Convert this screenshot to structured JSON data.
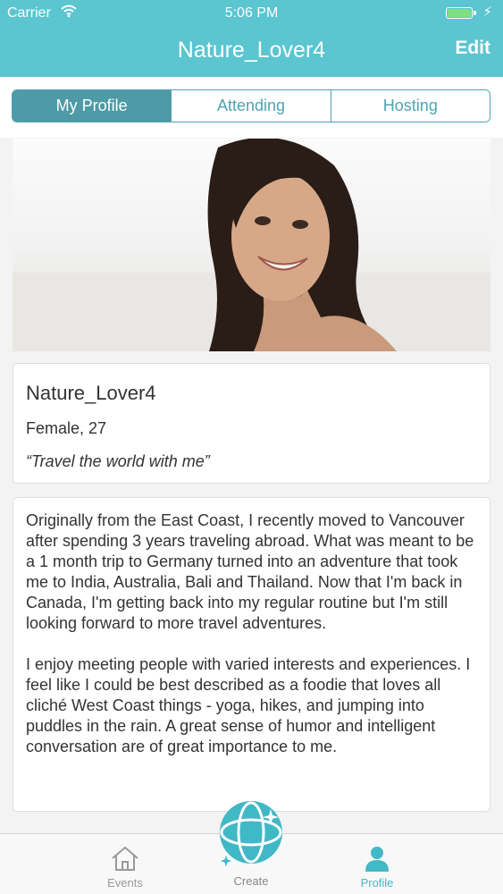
{
  "status_bar": {
    "carrier": "Carrier",
    "time": "5:06 PM",
    "battery_level": 1.0
  },
  "nav": {
    "title": "Nature_Lover4",
    "edit_label": "Edit"
  },
  "tabs": [
    {
      "label": "My Profile",
      "active": true
    },
    {
      "label": "Attending",
      "active": false
    },
    {
      "label": "Hosting",
      "active": false
    }
  ],
  "profile": {
    "username": "Nature_Lover4",
    "gender_age": "Female, 27",
    "tagline": "“Travel the world with me”",
    "bio": [
      "Originally from the East Coast, I recently moved to Vancouver after spending 3 years traveling abroad. What was meant to be a 1 month trip to Germany turned into an adventure that took me to India, Australia, Bali and Thailand. Now that I'm back in Canada, I'm getting back into my regular routine but I'm still looking forward to more travel adventures.",
      "I enjoy meeting people with varied interests and experiences. I feel like I could be best described as a foodie that loves all cliché West Coast things - yoga, hikes, and jumping into puddles in the rain. A great sense of humor and intelligent conversation are of great importance to me."
    ]
  },
  "tabbar": [
    {
      "label": "Events",
      "icon": "house-icon"
    },
    {
      "label": "Create",
      "icon": "globe-sparkle-icon"
    },
    {
      "label": "Profile",
      "icon": "person-icon",
      "active": true
    }
  ],
  "colors": {
    "header": "#5bc5d0",
    "accent": "#4e9aa6",
    "tab_active": "#43b9c7"
  }
}
